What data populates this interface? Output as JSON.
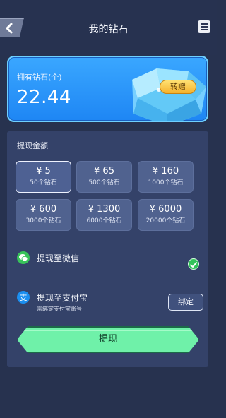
{
  "header": {
    "title": "我的钻石",
    "back_icon": "chevron-left-icon",
    "menu_icon": "menu-icon"
  },
  "balance": {
    "label": "拥有钻石(个)",
    "value": "22.44",
    "transfer_label": "转赠",
    "gem_icon": "diamond-icon"
  },
  "withdraw": {
    "section_title": "提现金额",
    "options": [
      {
        "price": "¥ 5",
        "sub": "50个钻石",
        "selected": true
      },
      {
        "price": "¥ 65",
        "sub": "500个钻石",
        "selected": false
      },
      {
        "price": "¥ 160",
        "sub": "1000个钻石",
        "selected": false
      },
      {
        "price": "¥ 600",
        "sub": "3000个钻石",
        "selected": false
      },
      {
        "price": "¥ 1300",
        "sub": "6000个钻石",
        "selected": false
      },
      {
        "price": "¥ 6000",
        "sub": "20000个钻石",
        "selected": false
      }
    ],
    "wechat": {
      "label": "提现至微信",
      "icon": "wechat-icon",
      "selected": true
    },
    "alipay": {
      "label": "提现至支付宝",
      "sub": "需绑定支付宝账号",
      "icon": "alipay-icon",
      "bind_label": "绑定"
    },
    "submit_label": "提现"
  },
  "colors": {
    "background": "#27324f",
    "card_blue": "#2a96fb",
    "accent_green": "#6ff1a9",
    "gold": "#f5b22c"
  }
}
